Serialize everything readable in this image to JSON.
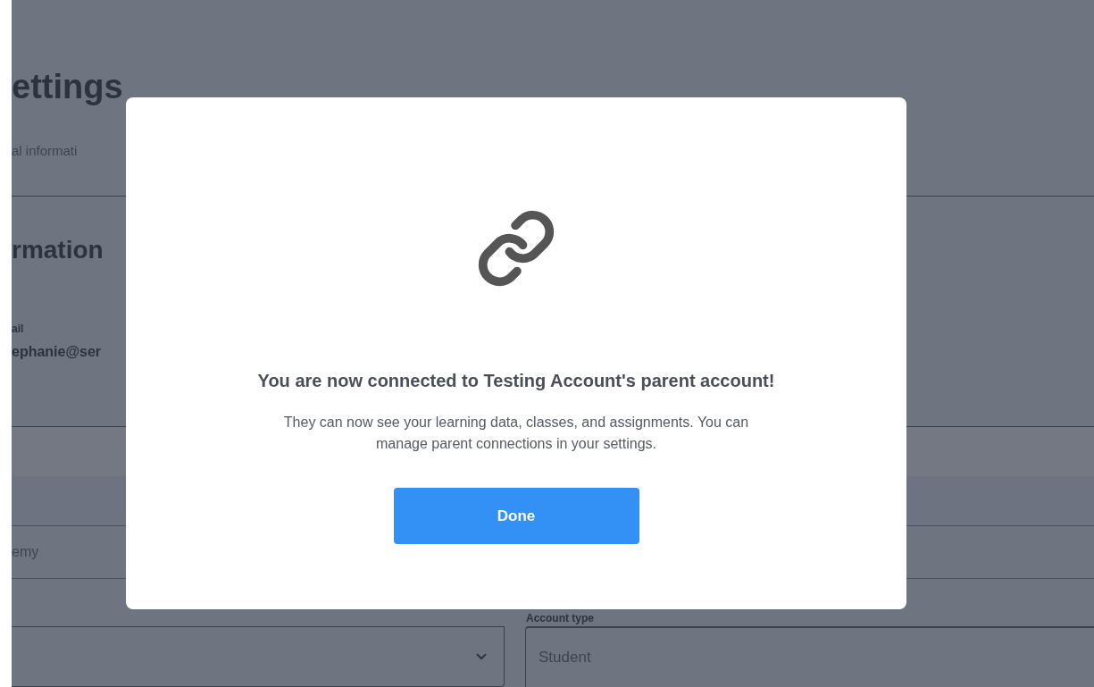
{
  "page": {
    "title": "ettings",
    "tab": "al informati",
    "section_heading": "rmation",
    "email": {
      "label": "ail",
      "value": "ephanie@ser"
    },
    "school_field": {
      "value": "emy"
    },
    "account_type": {
      "label": "Account type",
      "value": "Student"
    }
  },
  "modal": {
    "heading": "You are now connected to Testing Account's parent account!",
    "message": "They can now see your learning data, classes, and assignments. You can manage parent connections in your settings.",
    "button": "Done"
  }
}
